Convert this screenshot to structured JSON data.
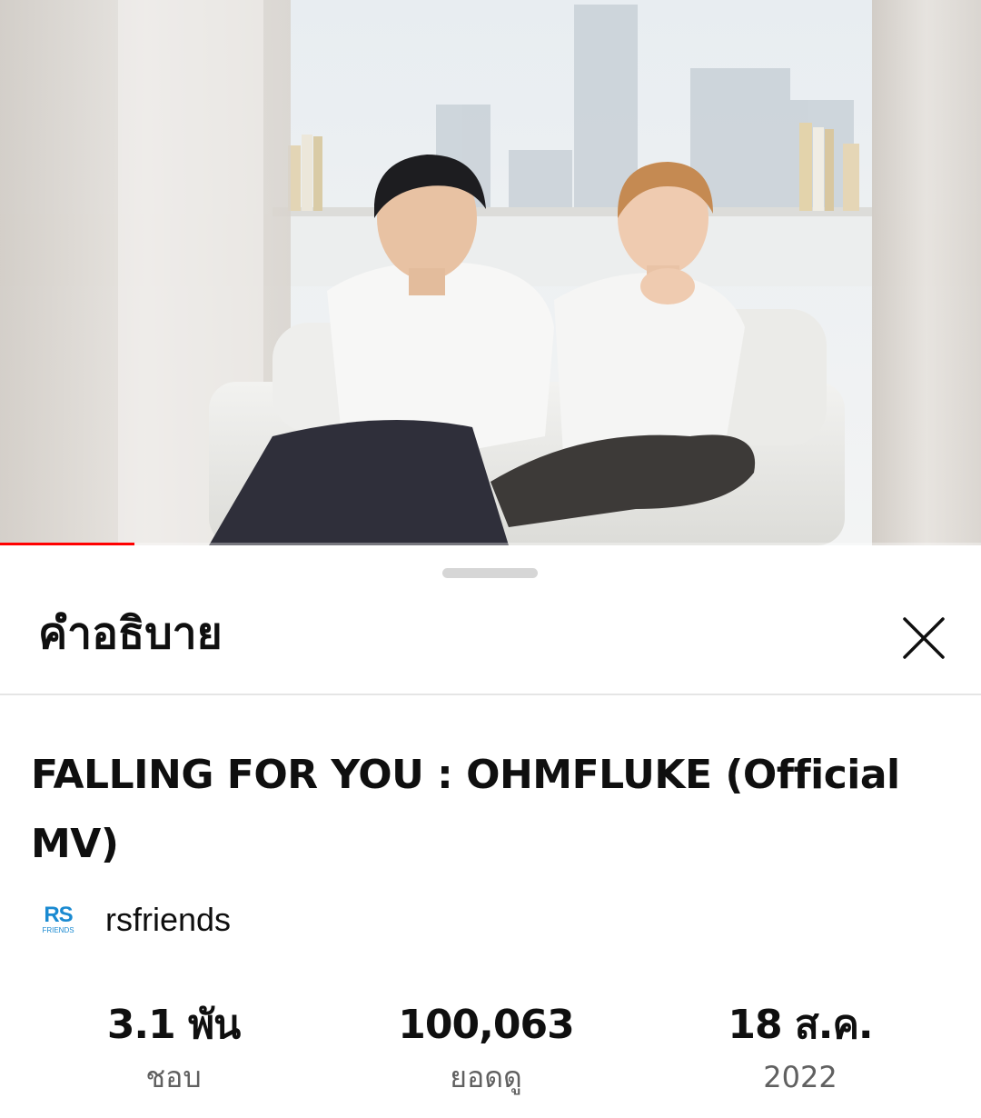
{
  "video": {
    "progress_fraction": 0.137
  },
  "sheet": {
    "title": "คำอธิบาย",
    "close_icon": "close-icon"
  },
  "details": {
    "title": "FALLING FOR YOU : OHMFLUKE (Official MV)",
    "channel": {
      "logo_text": "RS",
      "logo_subtext": "FRIENDS",
      "name": "rsfriends"
    },
    "stats": [
      {
        "value": "3.1 พัน",
        "label": "ชอบ"
      },
      {
        "value": "100,063",
        "label": "ยอดดู"
      },
      {
        "value": "18 ส.ค.",
        "label": "2022"
      }
    ]
  },
  "colors": {
    "progress": "#ff0000",
    "channel_logo": "#1a8ad1"
  }
}
